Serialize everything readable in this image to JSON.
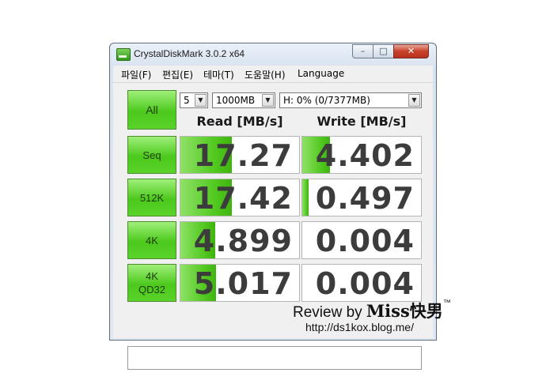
{
  "window": {
    "title": "CrystalDiskMark 3.0.2 x64"
  },
  "controls": {
    "minimize": "–",
    "maximize": "□",
    "close": "✕"
  },
  "menu": [
    "파일(F)",
    "편집(E)",
    "테마(T)",
    "도움말(H)",
    "Language"
  ],
  "toolbar": {
    "all_label": "All",
    "count": "5",
    "size": "1000MB",
    "drive": "H: 0% (0/7377MB)"
  },
  "headers": {
    "read": "Read [MB/s]",
    "write": "Write [MB/s]"
  },
  "results": [
    {
      "label": [
        "Seq"
      ],
      "read": "17.27",
      "write": "4.402",
      "read_fill": 0.43,
      "write_fill": 0.23
    },
    {
      "label": [
        "512K"
      ],
      "read": "17.42",
      "write": "0.497",
      "read_fill": 0.43,
      "write_fill": 0.05
    },
    {
      "label": [
        "4K"
      ],
      "read": "4.899",
      "write": "0.004",
      "read_fill": 0.29,
      "write_fill": 0.0
    },
    {
      "label": [
        "4K",
        "QD32"
      ],
      "read": "5.017",
      "write": "0.004",
      "read_fill": 0.3,
      "write_fill": 0.0
    }
  ],
  "watermark": {
    "review": "Review by ",
    "brand": "Miss快男",
    "tm": "™",
    "url": "http://ds1kox.blog.me/"
  },
  "colors": {
    "accent_green": "#4cc91c",
    "window_frame": "#d9e3ef",
    "close_red": "#c7402a"
  }
}
